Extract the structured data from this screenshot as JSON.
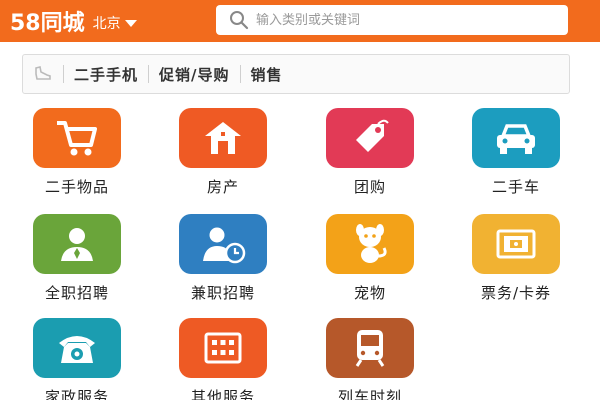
{
  "header": {
    "logo": "58同城",
    "city": "北京",
    "search_placeholder": "输入类别或关键词",
    "bg_color": "#f26b1d"
  },
  "catbar": {
    "icon": "shoe-icon",
    "crumbs": [
      "二手手机",
      "促销/导购",
      "销售"
    ]
  },
  "tiles": [
    {
      "label": "二手物品",
      "icon": "shopping-cart-icon",
      "color": "#f26b1d"
    },
    {
      "label": "房产",
      "icon": "house-icon",
      "color": "#ef5a24"
    },
    {
      "label": "团购",
      "icon": "tag-icon",
      "color": "#e23a56"
    },
    {
      "label": "二手车",
      "icon": "car-icon",
      "color": "#1c9dbf"
    },
    {
      "label": "全职招聘",
      "icon": "person-icon",
      "color": "#6aa53a"
    },
    {
      "label": "兼职招聘",
      "icon": "person-clock-icon",
      "color": "#2f7fc1"
    },
    {
      "label": "宠物",
      "icon": "pet-icon",
      "color": "#f3a218"
    },
    {
      "label": "票务/卡券",
      "icon": "ticket-icon",
      "color": "#f1b232"
    },
    {
      "label": "家政服务",
      "icon": "telephone-icon",
      "color": "#1b9db0"
    },
    {
      "label": "其他服务",
      "icon": "grid-icon",
      "color": "#ee5a24"
    },
    {
      "label": "列车时刻",
      "icon": "train-icon",
      "color": "#b6582a"
    }
  ]
}
